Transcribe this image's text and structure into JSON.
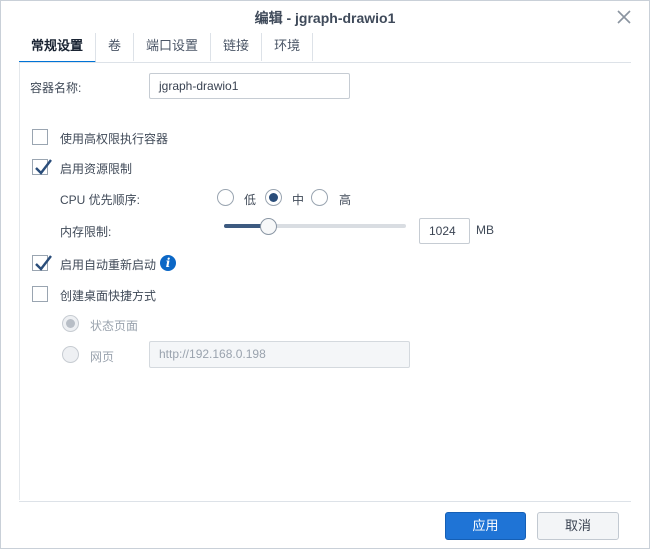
{
  "dialog": {
    "title": "编辑 - jgraph-drawio1"
  },
  "tabs": [
    {
      "label": "常规设置",
      "active": true
    },
    {
      "label": "卷"
    },
    {
      "label": "端口设置"
    },
    {
      "label": "链接"
    },
    {
      "label": "环境"
    }
  ],
  "form": {
    "container_name_label": "容器名称:",
    "container_name_value": "jgraph-drawio1",
    "high_privilege": {
      "label": "使用高权限执行容器",
      "checked": false
    },
    "resource_limit": {
      "label": "启用资源限制",
      "checked": true
    },
    "cpu_priority": {
      "label": "CPU 优先顺序:",
      "options": [
        "低",
        "中",
        "高"
      ],
      "selected": "中"
    },
    "memory_limit": {
      "label": "内存限制:",
      "value": "1024",
      "unit": "MB",
      "slider_fraction": 0.24
    },
    "auto_restart": {
      "label": "启用自动重新启动",
      "checked": true,
      "info_icon": "info-icon"
    },
    "desktop_shortcut": {
      "label": "创建桌面快捷方式",
      "checked": false,
      "options": [
        {
          "label": "状态页面",
          "selected": true
        },
        {
          "label": "网页",
          "selected": false
        }
      ],
      "url_placeholder": "http://192.168.0.198"
    }
  },
  "footer": {
    "apply_label": "应用",
    "cancel_label": "取消"
  },
  "colors": {
    "accent": "#1f74d6",
    "check": "#2a4d7a"
  }
}
